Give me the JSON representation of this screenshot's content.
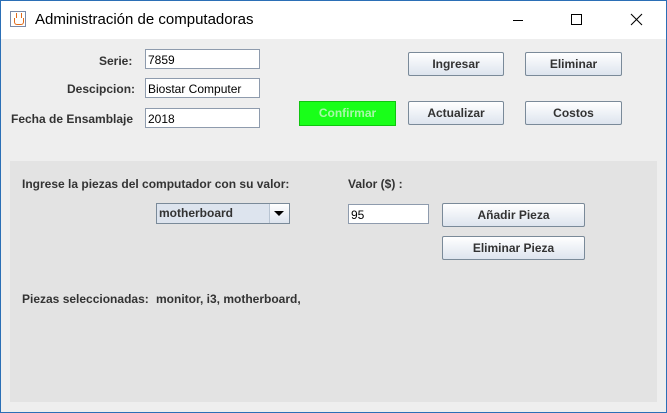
{
  "window": {
    "title": "Administración de computadoras"
  },
  "form": {
    "serie_label": "Serie:",
    "serie_value": "7859",
    "descripcion_label": "Descipcion:",
    "descripcion_value": "Biostar Computer",
    "fecha_label": "Fecha de Ensamblaje",
    "fecha_value": "2018"
  },
  "buttons": {
    "confirmar": "Confirmar",
    "ingresar": "Ingresar",
    "eliminar": "Eliminar",
    "actualizar": "Actualizar",
    "costos": "Costos"
  },
  "piezas": {
    "prompt": "Ingrese la piezas del computador con su valor:",
    "valor_label": "Valor ($) :",
    "selected_option": "motherboard",
    "valor_value": "95",
    "add_button": "Añadir Pieza",
    "remove_button": "Eliminar Pieza",
    "selected_label": "Piezas seleccionadas:",
    "selected_list": "monitor, i3, motherboard,"
  },
  "colors": {
    "confirm_button_bg": "#19ff19",
    "window_border": "#2b6fb6",
    "panel_bg": "#e3e3e3"
  }
}
